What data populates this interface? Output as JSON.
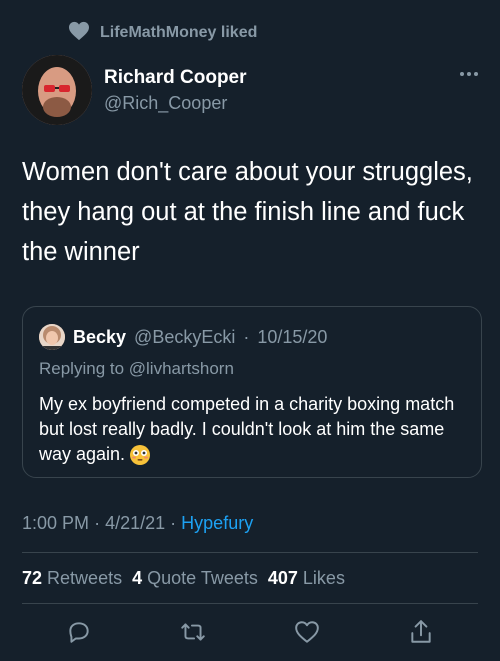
{
  "social_context": {
    "liker": "LifeMathMoney",
    "action": "liked"
  },
  "author": {
    "name": "Richard Cooper",
    "handle": "@Rich_Cooper"
  },
  "tweet": {
    "text": "Women don't care about your struggles, they hang out at the finish line and fuck the winner"
  },
  "quoted": {
    "name": "Becky",
    "handle": "@BeckyEcki",
    "separator": "·",
    "date": "10/15/20",
    "replying_to": "Replying to @livhartshorn",
    "text": "My ex boyfriend competed in a charity boxing match but lost really badly. I couldn't look at him the same way again."
  },
  "meta": {
    "time": "1:00 PM",
    "sep1": "·",
    "date": "4/21/21",
    "sep2": "·",
    "source": "Hypefury"
  },
  "stats": {
    "retweets_count": "72",
    "retweets_label": "Retweets",
    "quotes_count": "4",
    "quotes_label": "Quote Tweets",
    "likes_count": "407",
    "likes_label": "Likes"
  },
  "colors": {
    "background": "#15202b",
    "secondary_text": "#8899a6",
    "link": "#1da1f2",
    "border": "#38444d"
  },
  "icons": [
    "heart-icon",
    "more-icon",
    "reply-icon",
    "retweet-icon",
    "like-icon",
    "share-icon",
    "flushed-emoji"
  ]
}
